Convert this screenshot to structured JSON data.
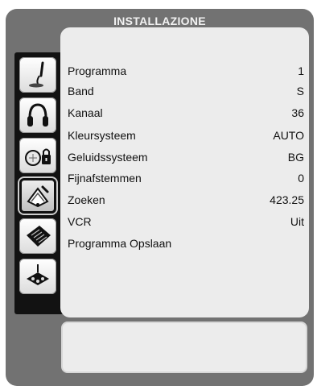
{
  "title": "INSTALLAZIONE",
  "sidebar": {
    "icons": [
      {
        "name": "picture-icon"
      },
      {
        "name": "sound-icon"
      },
      {
        "name": "features-lock-icon"
      },
      {
        "name": "installation-icon",
        "selected": true
      },
      {
        "name": "source-list-icon"
      },
      {
        "name": "source-connector-icon"
      }
    ]
  },
  "menu": {
    "items": [
      {
        "label": "Programma",
        "value": "1"
      },
      {
        "label": "Band",
        "value": "S"
      },
      {
        "label": "Kanaal",
        "value": "36"
      },
      {
        "label": "Kleursysteem",
        "value": "AUTO"
      },
      {
        "label": "Geluidssysteem",
        "value": "BG"
      },
      {
        "label": "Fijnafstemmen",
        "value": "0"
      },
      {
        "label": "Zoeken",
        "value": "423.25"
      },
      {
        "label": "VCR",
        "value": "Uit"
      },
      {
        "label": "Programma Opslaan",
        "value": ""
      }
    ]
  },
  "colors": {
    "frame": "#727272",
    "panel": "#ececec",
    "icon_column": "#121212"
  }
}
